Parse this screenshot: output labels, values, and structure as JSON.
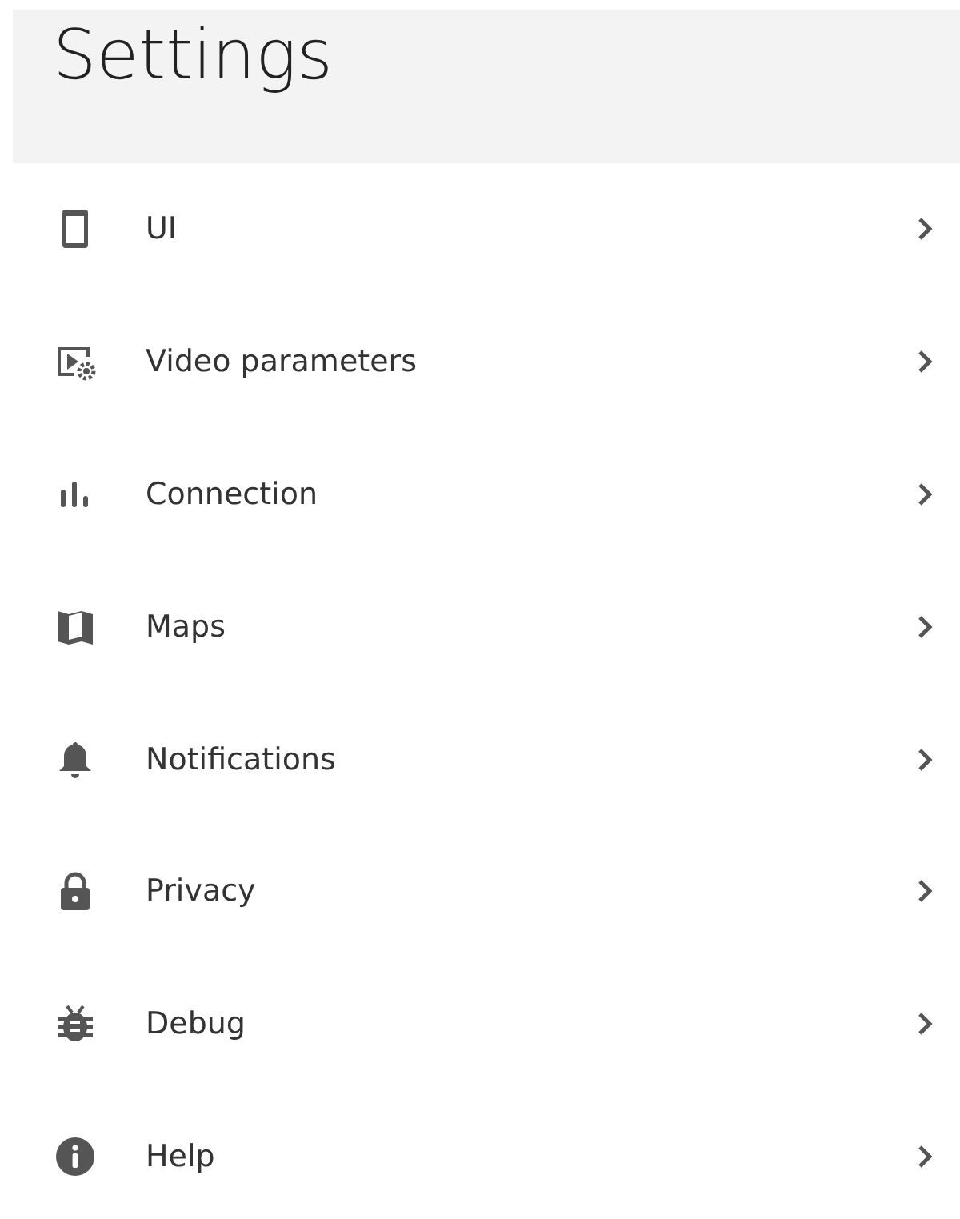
{
  "header": {
    "title": "Settings"
  },
  "items": [
    {
      "label": "UI"
    },
    {
      "label": "Video parameters"
    },
    {
      "label": "Connection"
    },
    {
      "label": "Maps"
    },
    {
      "label": "Notifications"
    },
    {
      "label": "Privacy"
    },
    {
      "label": "Debug"
    },
    {
      "label": "Help"
    }
  ]
}
